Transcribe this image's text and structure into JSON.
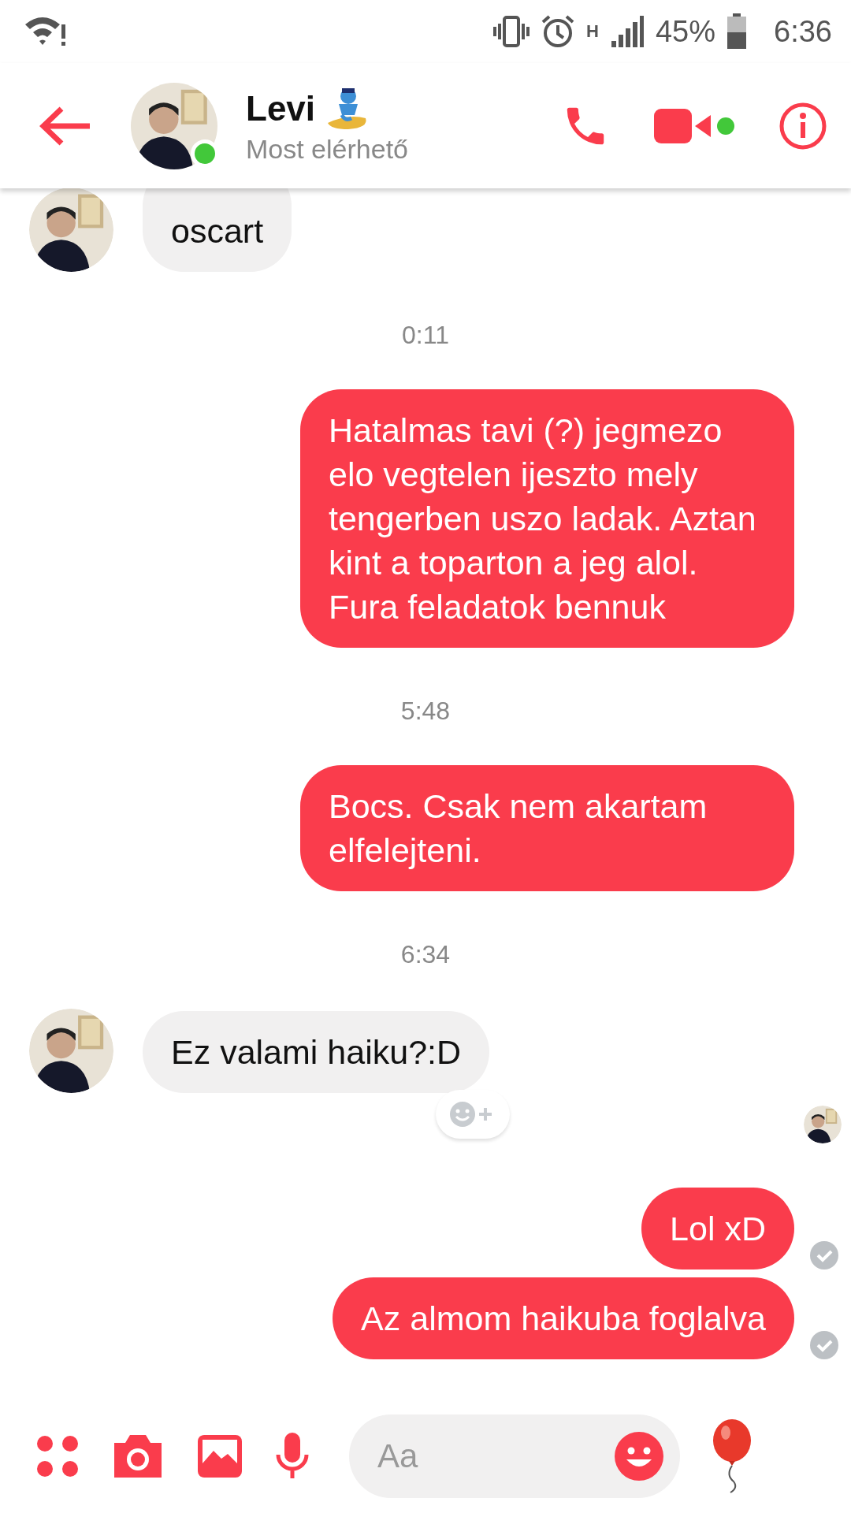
{
  "status_bar": {
    "battery": "45%",
    "time": "6:36",
    "network": "H"
  },
  "header": {
    "name": "Levi",
    "status": "Most elérhető",
    "online": true,
    "video_online": true
  },
  "messages": [
    {
      "kind": "incoming",
      "text": "oscart"
    },
    {
      "kind": "time",
      "text": "0:11"
    },
    {
      "kind": "outgoing",
      "text": "Hatalmas tavi (?) jegmezo elo vegtelen ijeszto mely tengerben uszo ladak. Aztan kint a toparton a jeg alol. Fura feladatok bennuk",
      "delivered": false
    },
    {
      "kind": "time",
      "text": "5:48"
    },
    {
      "kind": "outgoing",
      "text": "Bocs. Csak nem akartam elfelejteni.",
      "delivered": false
    },
    {
      "kind": "time",
      "text": "6:34"
    },
    {
      "kind": "incoming",
      "text": "Ez valami haiku?:D"
    },
    {
      "kind": "reactions"
    },
    {
      "kind": "outgoing",
      "text": "Lol xD",
      "delivered": true
    },
    {
      "kind": "outgoing",
      "text": "Az almom haikuba foglalva",
      "delivered": true
    }
  ],
  "composer": {
    "placeholder": "Aa"
  }
}
